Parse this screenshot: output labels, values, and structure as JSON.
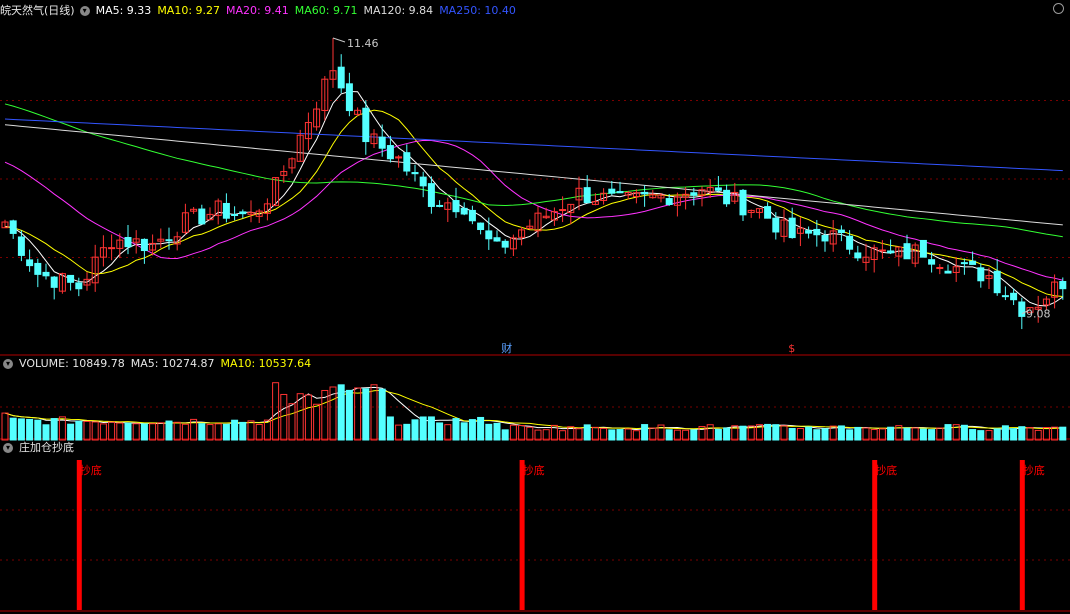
{
  "header": {
    "stock_name": "皖天然气(日线)",
    "ma_labels": [
      {
        "key": "ma5",
        "text": "MA5: 9.33",
        "color": "#ffffff"
      },
      {
        "key": "ma10",
        "text": "MA10: 9.27",
        "color": "#ffff00"
      },
      {
        "key": "ma20",
        "text": "MA20: 9.41",
        "color": "#ff33ff"
      },
      {
        "key": "ma60",
        "text": "MA60: 9.71",
        "color": "#33ff33"
      },
      {
        "key": "ma120",
        "text": "MA120: 9.84",
        "color": "#dcdcdc"
      },
      {
        "key": "ma250",
        "text": "MA250: 10.40",
        "color": "#3355ff"
      }
    ]
  },
  "volume_header": {
    "volume_text": "VOLUME: 10849.78",
    "ma5_text": "MA5: 10274.87",
    "ma10_text": "MA10: 10537.64"
  },
  "indicator_header": {
    "title": "庄加仓抄底"
  },
  "colors": {
    "up": "#ff3333",
    "down": "#54ffff",
    "signal": "#ff0000",
    "grid": "#7a0000"
  },
  "chart_data": {
    "type": "candlestick",
    "price_ylim": [
      8.85,
      11.6
    ],
    "high_annotation": {
      "text": "11.46",
      "value": 11.46,
      "index": 40
    },
    "low_annotation": {
      "text": "9.08",
      "value": 9.08,
      "index": 125
    },
    "markers": [
      {
        "text": "财",
        "index": 61,
        "color": "#5aa0ff"
      },
      {
        "text": "$",
        "index": 96,
        "color": "#ff3333"
      }
    ],
    "signals": [
      {
        "index": 9,
        "label": "抄底"
      },
      {
        "index": 63,
        "label": "抄底"
      },
      {
        "index": 106,
        "label": "抄底"
      },
      {
        "index": 124,
        "label": "抄底"
      }
    ]
  }
}
